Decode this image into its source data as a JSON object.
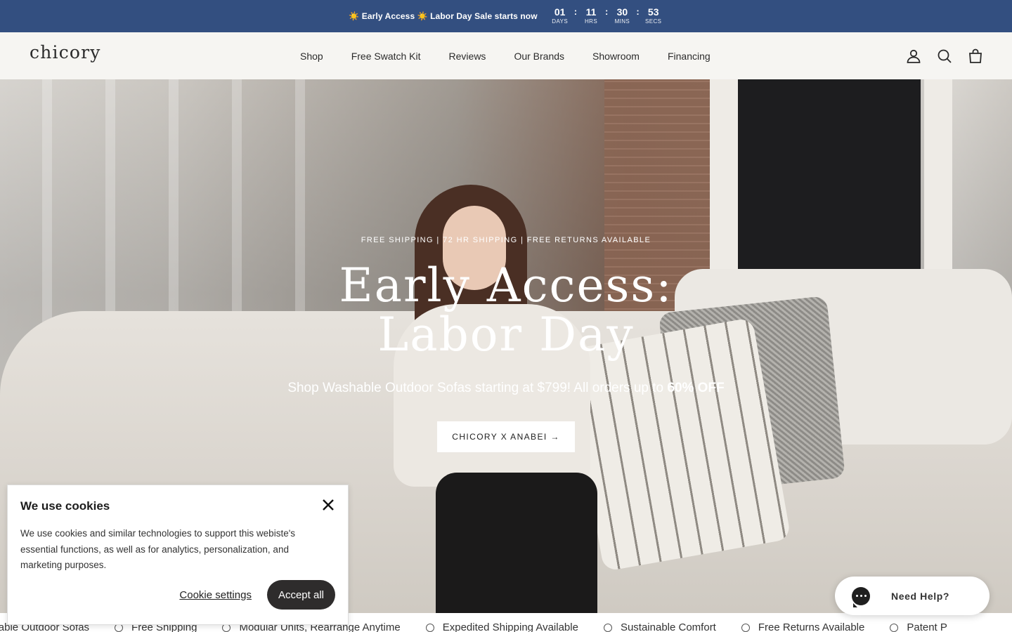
{
  "announcement": {
    "text": "☀️ Early Access ☀️ Labor Day Sale starts now",
    "countdown": [
      {
        "value": "01",
        "label": "DAYS"
      },
      {
        "value": "11",
        "label": "HRS"
      },
      {
        "value": "30",
        "label": "MINS"
      },
      {
        "value": "53",
        "label": "SECS"
      }
    ],
    "separator": ":",
    "bg_color": "#334f80"
  },
  "header": {
    "logo": "chicory",
    "nav": [
      {
        "label": "Shop"
      },
      {
        "label": "Free Swatch Kit"
      },
      {
        "label": "Reviews"
      },
      {
        "label": "Our Brands"
      },
      {
        "label": "Showroom"
      },
      {
        "label": "Financing"
      }
    ],
    "icons": [
      "account-icon",
      "search-icon",
      "cart-icon"
    ]
  },
  "hero": {
    "kicker": "FREE SHIPPING | 72 HR SHIPPING | FREE RETURNS AVAILABLE",
    "title_line1": "Early Access:",
    "title_line2": "Labor Day",
    "subtitle_prefix": "Shop Washable Outdoor Sofas starting at $799! All orders up to ",
    "subtitle_bold": "60% OFF",
    "cta": "CHICORY X ANABEI →"
  },
  "marquee": {
    "items": [
      "Washable Outdoor Sofas",
      "Free Shipping",
      "Modular Units, Rearrange Anytime",
      "Expedited Shipping Available",
      "Sustainable Comfort",
      "Free Returns Available",
      "Patent P"
    ]
  },
  "cookie": {
    "title": "We use cookies",
    "text": "We use cookies and similar technologies to support this webiste's essential functions, as well as for analytics, personalization, and marketing purposes.",
    "settings": "Cookie settings",
    "accept": "Accept all"
  },
  "help": {
    "label": "Need Help?"
  }
}
